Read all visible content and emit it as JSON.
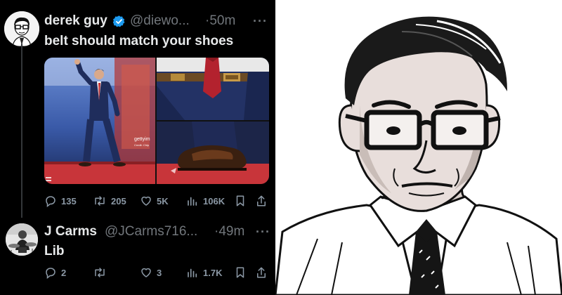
{
  "tweets": [
    {
      "display_name": "derek guy",
      "handle": "@diewo...",
      "time": "·50m",
      "more": "···",
      "text": "belt should match your shoes",
      "watermark_line1": "gettyim",
      "watermark_line2": "Credit: Chip",
      "actions": {
        "replies": "135",
        "retweets": "205",
        "likes": "5K",
        "views": "106K"
      }
    },
    {
      "display_name": "J Carms",
      "handle": "@JCarms716...",
      "time": "·49m",
      "more": "···",
      "text": "Lib",
      "actions": {
        "replies": "2",
        "retweets": "",
        "likes": "3",
        "views": "1.7K"
      }
    }
  ],
  "colors": {
    "background": "#000000",
    "primary_text": "#e7e9ea",
    "secondary_text": "#71767b",
    "verified": "#1d9bf0"
  },
  "icons": [
    "reply-icon",
    "retweet-icon",
    "like-icon",
    "views-icon",
    "bookmark-icon",
    "share-icon",
    "verified-badge-icon"
  ]
}
